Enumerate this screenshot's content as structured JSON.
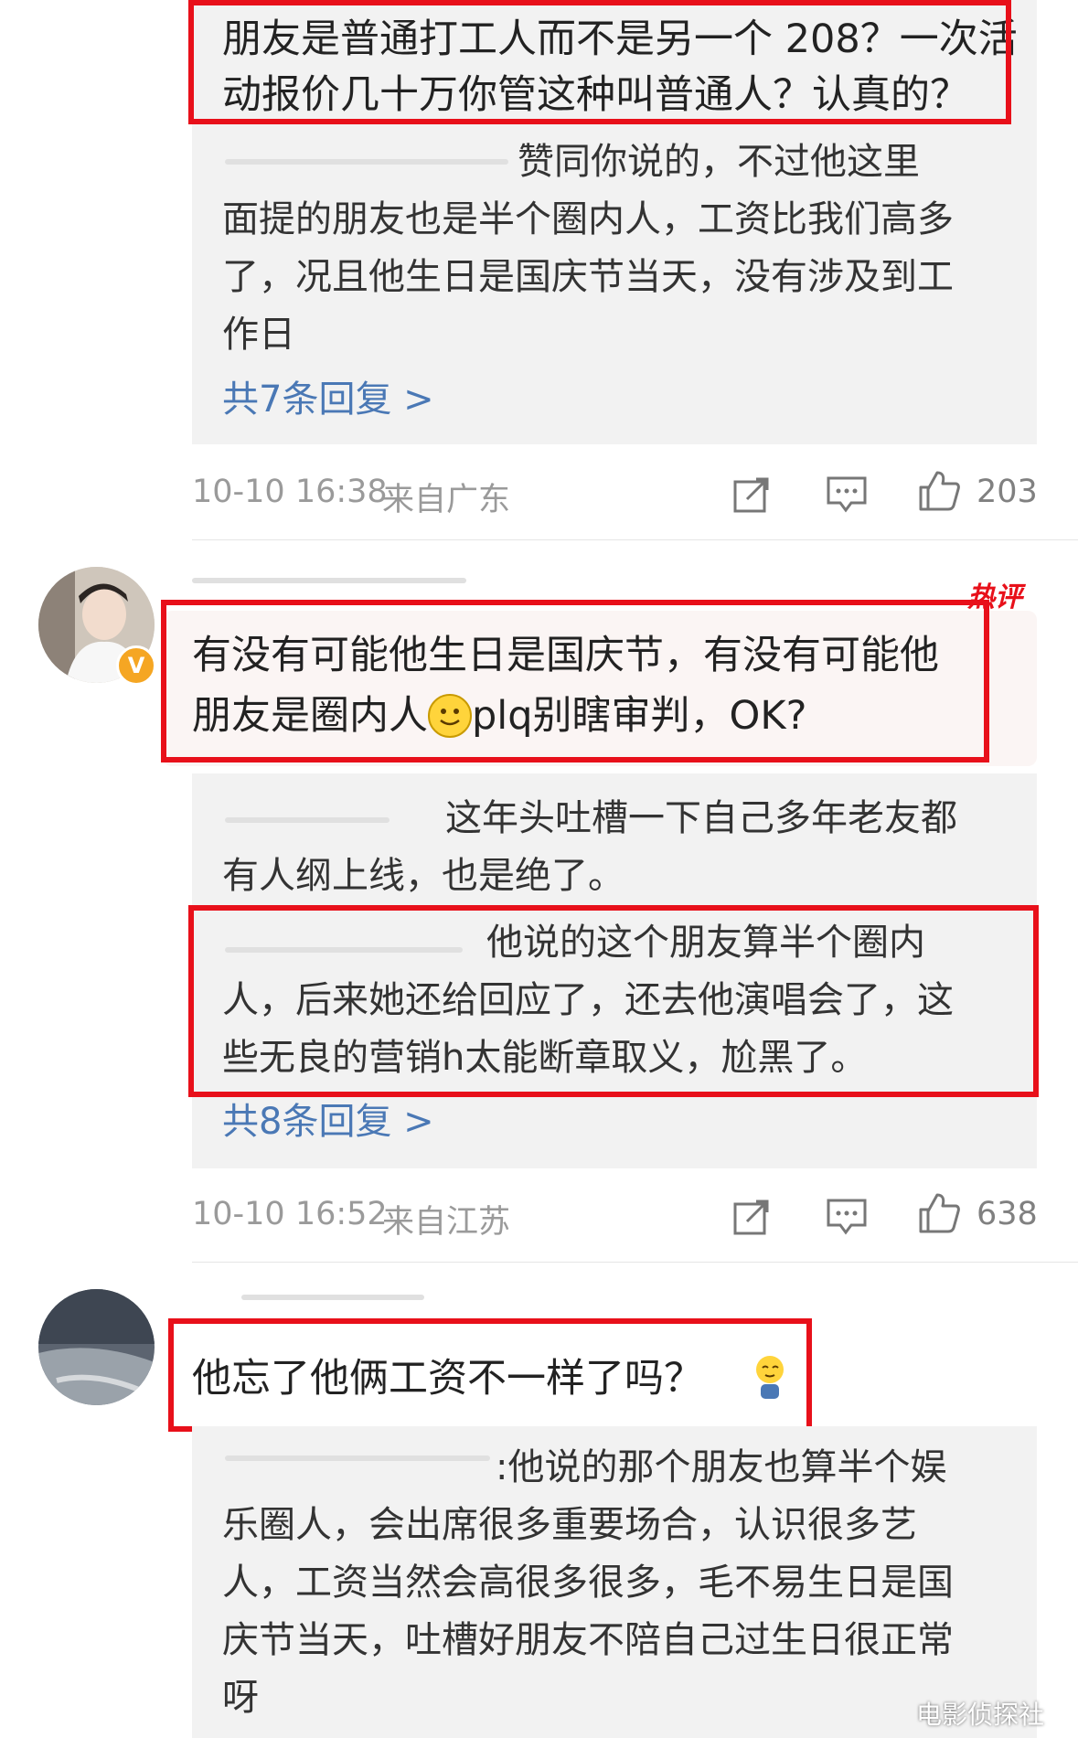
{
  "comment1": {
    "main_line1": "朋友是普通打工人而不是另一个 208？一次活",
    "main_line2": "动报价几十万你管这种叫普通人？认真的？",
    "reply_line1": "赞同你说的，不过他这里",
    "reply_line2": "面提的朋友也是半个圈内人，工资比我们高多",
    "reply_line3": "了，况且他生日是国庆节当天，没有涉及到工",
    "reply_line4": "作日",
    "more_replies": "共7条回复 >",
    "timestamp": "10-10 16:38",
    "location": "来自广东",
    "likes": "203"
  },
  "comment2": {
    "badge": "热评",
    "main_line1": "有没有可能他生日是国庆节，有没有可能他",
    "main_line2a": "朋友是圈内人",
    "main_line2b": "plq别瞎审判，OK?",
    "reply1_line1": "这年头吐槽一下自己多年老友都",
    "reply1_line2": "有人纲上线，也是绝了。",
    "reply2_line1": "他说的这个朋友算半个圈内",
    "reply2_line2": "人，后来她还给回应了，还去他演唱会了，这",
    "reply2_line3": "些无良的营销h太能断章取义，尬黑了。",
    "more_replies": "共8条回复 >",
    "timestamp": "10-10 16:52",
    "location": "来自江苏",
    "likes": "638",
    "verified_badge": "V"
  },
  "comment3": {
    "main_line1": "他忘了他俩工资不一样了吗？",
    "reply_line1": ":他说的那个朋友也算半个娱",
    "reply_line2": "乐圈人，会出席很多重要场合，认识很多艺",
    "reply_line3": "人，工资当然会高很多很多，毛不易生日是国",
    "reply_line4": "庆节当天，吐槽好朋友不陪自己过生日很正常",
    "reply_line5": "呀"
  },
  "watermark": "电影侦探社",
  "icons": [
    "share-icon",
    "comment-icon",
    "like-icon",
    "smile-emoji-icon",
    "verified-badge-icon"
  ],
  "colors": {
    "highlight": "#e8101a",
    "link": "#4a78b5",
    "reply_bg": "#f2f2f2"
  }
}
